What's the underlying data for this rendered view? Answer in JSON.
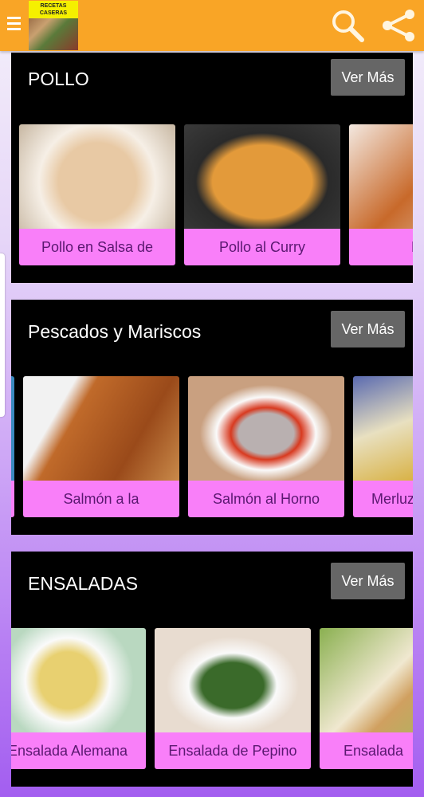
{
  "header": {
    "logo_text": "RECETAS CASERAS",
    "icons": [
      "menu-icon",
      "search-icon",
      "share-icon"
    ],
    "bg_color": "#f9a526"
  },
  "sections": [
    {
      "title": "POLLO",
      "button": "Ver Más",
      "cards": [
        {
          "label": "Pollo en Salsa de"
        },
        {
          "label": "Pollo al Curry"
        },
        {
          "label": "Pollo"
        }
      ]
    },
    {
      "title": "Pescados y Mariscos",
      "button": "Ver Más",
      "cards": [
        {
          "label": ""
        },
        {
          "label": "Salmón a la"
        },
        {
          "label": "Salmón al Horno"
        },
        {
          "label": "Merluza"
        }
      ]
    },
    {
      "title": "ENSALADAS",
      "button": "Ver Más",
      "cards": [
        {
          "label": "Ensalada Alemana"
        },
        {
          "label": "Ensalada de Pepino"
        },
        {
          "label": "Ensalada"
        }
      ]
    }
  ],
  "colors": {
    "card_label_bg": "#f97ff9",
    "card_label_text": "#5a1870",
    "button_bg": "#666666"
  }
}
